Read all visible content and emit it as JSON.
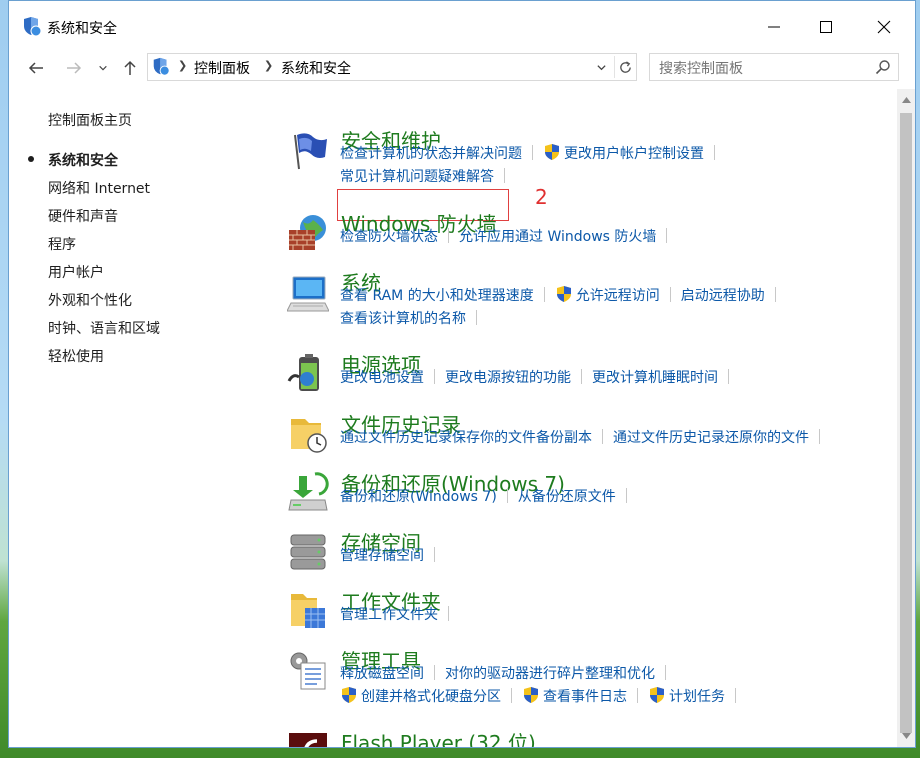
{
  "window": {
    "title": "系统和安全"
  },
  "address_bar": {
    "crumbs": [
      "控制面板",
      "系统和安全"
    ]
  },
  "search": {
    "placeholder": "搜索控制面板"
  },
  "sidebar": {
    "home": "控制面板主页",
    "items": [
      {
        "label": "系统和安全",
        "current": true
      },
      {
        "label": "网络和 Internet"
      },
      {
        "label": "硬件和声音"
      },
      {
        "label": "程序"
      },
      {
        "label": "用户帐户"
      },
      {
        "label": "外观和个性化"
      },
      {
        "label": "时钟、语言和区域"
      },
      {
        "label": "轻松使用"
      }
    ]
  },
  "categories": [
    {
      "title": "安全和维护",
      "icon": "security-flag-icon",
      "lines": [
        [
          "检查计算机的状态并解决问题",
          "!更改用户帐户控制设置"
        ],
        [
          "常见计算机问题疑难解答"
        ]
      ]
    },
    {
      "title": "Windows 防火墙",
      "icon": "firewall-icon",
      "lines": [
        [
          "检查防火墙状态",
          "允许应用通过 Windows 防火墙"
        ]
      ]
    },
    {
      "title": "系统",
      "icon": "system-computer-icon",
      "lines": [
        [
          "查看 RAM 的大小和处理器速度",
          "!允许远程访问",
          "启动远程协助"
        ],
        [
          "查看该计算机的名称"
        ]
      ]
    },
    {
      "title": "电源选项",
      "icon": "power-options-icon",
      "lines": [
        [
          "更改电池设置",
          "更改电源按钮的功能",
          "更改计算机睡眠时间"
        ]
      ]
    },
    {
      "title": "文件历史记录",
      "icon": "file-history-icon",
      "lines": [
        [
          "通过文件历史记录保存你的文件备份副本",
          "通过文件历史记录还原你的文件"
        ]
      ]
    },
    {
      "title": "备份和还原(Windows 7)",
      "icon": "backup-restore-icon",
      "lines": [
        [
          "备份和还原(Windows 7)",
          "从备份还原文件"
        ]
      ]
    },
    {
      "title": "存储空间",
      "icon": "storage-spaces-icon",
      "lines": [
        [
          "管理存储空间"
        ]
      ]
    },
    {
      "title": "工作文件夹",
      "icon": "work-folders-icon",
      "lines": [
        [
          "管理工作文件夹"
        ]
      ]
    },
    {
      "title": "管理工具",
      "icon": "admin-tools-icon",
      "lines": [
        [
          "释放磁盘空间",
          "对你的驱动器进行碎片整理和优化"
        ],
        [
          "!创建并格式化硬盘分区",
          "!查看事件日志",
          "!计划任务"
        ]
      ]
    },
    {
      "title": "Flash Player (32 位)",
      "icon": "flash-player-icon",
      "lines": []
    }
  ],
  "annotation": {
    "label": "2",
    "color": "#e03030"
  },
  "colors": {
    "category_title": "#1e7b1e",
    "link": "#0c58a8",
    "highlight_box": "#e04040"
  }
}
